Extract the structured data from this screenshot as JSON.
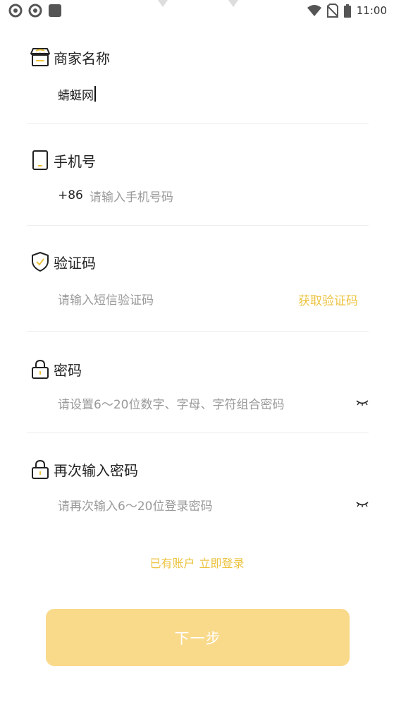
{
  "status_bar": {
    "time": "11:00",
    "left_icons": [
      "sync-icon",
      "sync-icon",
      "app-square-icon"
    ],
    "right_icons": [
      "wifi-icon",
      "no-sim-icon",
      "battery-icon"
    ]
  },
  "form": {
    "shop_name": {
      "label": "商家名称",
      "icon": "store-icon",
      "value": "蜻蜓网"
    },
    "phone": {
      "label": "手机号",
      "icon": "phone-icon",
      "prefix": "+86",
      "placeholder": "请输入手机号码"
    },
    "verify_code": {
      "label": "验证码",
      "icon": "shield-check-icon",
      "placeholder": "请输入短信验证码",
      "get_code_label": "获取验证码"
    },
    "password": {
      "label": "密码",
      "icon": "lock-icon",
      "placeholder": "请设置6～20位数字、字母、字符组合密码",
      "toggle_icon": "eye-closed-icon"
    },
    "confirm_password": {
      "label": "再次输入密码",
      "icon": "lock-icon",
      "placeholder": "请再次输入6～20位登录密码",
      "toggle_icon": "eye-closed-icon"
    }
  },
  "login_link": {
    "prefix": "已有账户",
    "action": "立即登录"
  },
  "next_button": {
    "label": "下一步"
  },
  "colors": {
    "accent": "#ecc33f",
    "button_bg": "#f9d98a",
    "placeholder": "#9a9a9a",
    "divider": "#eeeeee"
  }
}
